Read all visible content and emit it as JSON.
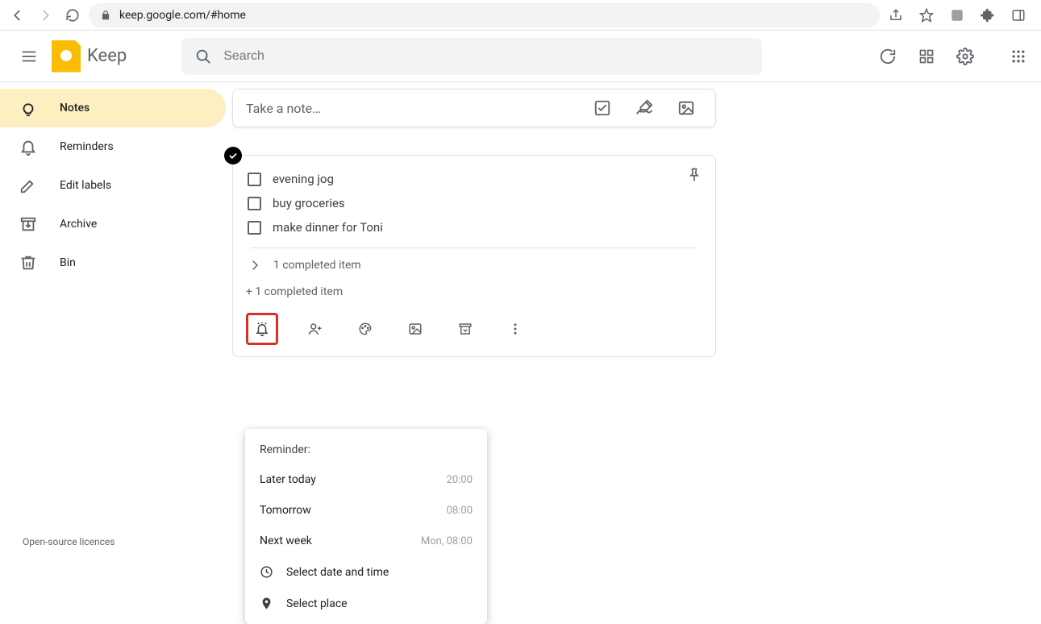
{
  "browser": {
    "url": "keep.google.com/#home"
  },
  "app": {
    "title": "Keep",
    "search_placeholder": "Search"
  },
  "sidebar": {
    "items": [
      {
        "label": "Notes"
      },
      {
        "label": "Reminders"
      },
      {
        "label": "Edit labels"
      },
      {
        "label": "Archive"
      },
      {
        "label": "Bin"
      }
    ],
    "licences": "Open-source licences"
  },
  "take_note": {
    "placeholder": "Take a note…"
  },
  "note": {
    "items": [
      {
        "text": "evening jog"
      },
      {
        "text": "buy groceries"
      },
      {
        "text": "make dinner for Toni"
      }
    ],
    "completed_label": "1 completed item",
    "plus_completed": "+ 1 completed item"
  },
  "reminder_menu": {
    "title": "Reminder:",
    "rows": [
      {
        "label": "Later today",
        "time": "20:00"
      },
      {
        "label": "Tomorrow",
        "time": "08:00"
      },
      {
        "label": "Next week",
        "time": "Mon, 08:00"
      }
    ],
    "select_datetime": "Select date and time",
    "select_place": "Select place"
  }
}
